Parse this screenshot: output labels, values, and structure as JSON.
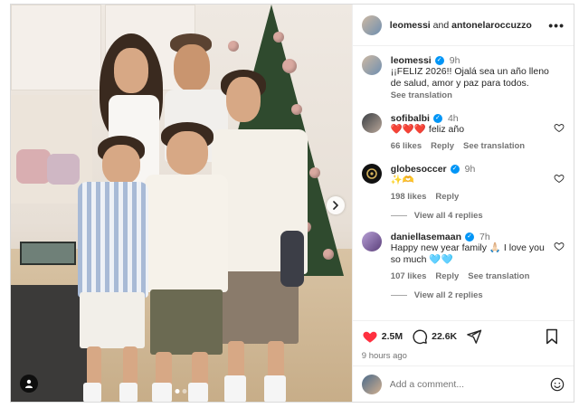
{
  "header": {
    "user1": "leomessi",
    "connector": "and",
    "user2": "antonelaroccuzzo",
    "more": "•••"
  },
  "caption": {
    "username": "leomessi",
    "time": "9h",
    "text": "¡¡FELIZ 2026!! Ojalá sea un año lleno de salud, amor y paz para todos.",
    "see_translation": "See translation"
  },
  "comments": [
    {
      "username": "sofibalbi",
      "time": "4h",
      "text": "❤️❤️❤️ feliz año",
      "likes": "66 likes",
      "reply": "Reply",
      "see_translation": "See translation"
    },
    {
      "username": "globesoccer",
      "time": "9h",
      "text": "✨🫶",
      "likes": "198 likes",
      "reply": "Reply",
      "view_replies": "View all 4 replies"
    },
    {
      "username": "daniellasemaan",
      "time": "7h",
      "text": "Happy new year family 🙏🏻 I love you so much 🩵🩵",
      "likes": "107 likes",
      "reply": "Reply",
      "see_translation": "See translation",
      "view_replies": "View all 2 replies"
    }
  ],
  "actions": {
    "likes_count": "2.5M",
    "comments_count": "22.6K"
  },
  "posted_ago": "9 hours ago",
  "add_comment": {
    "placeholder": "Add a comment..."
  },
  "media": {
    "slide_count": 2,
    "active_slide": 1
  },
  "colors": {
    "verified": "#0095f6",
    "like_red": "#ff3040",
    "text_primary": "#262626",
    "text_secondary": "#737373"
  },
  "icons": [
    "more-icon",
    "verified-icon",
    "heart-icon",
    "comment-icon",
    "share-icon",
    "bookmark-icon",
    "emoji-icon",
    "chevron-right-icon",
    "user-tag-icon"
  ]
}
